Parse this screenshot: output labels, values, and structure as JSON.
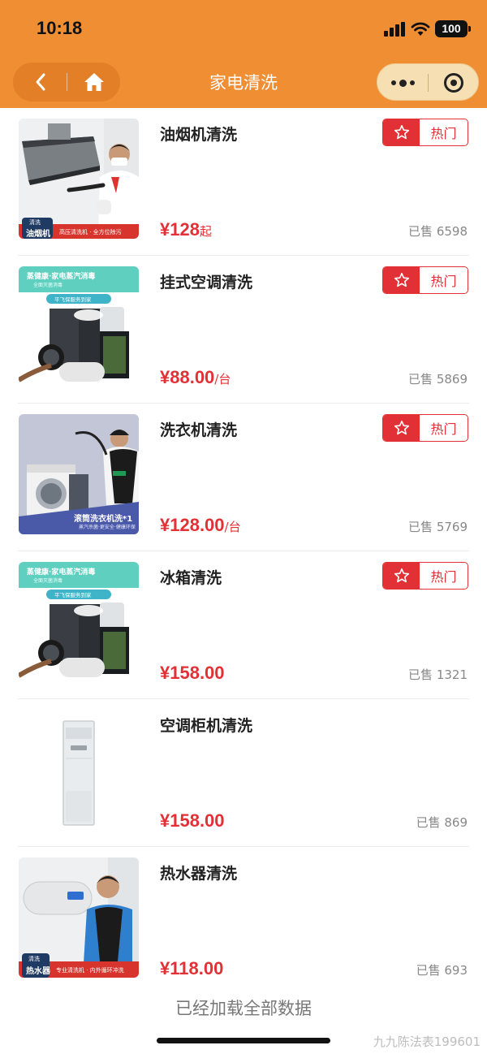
{
  "status_bar": {
    "time": "10:18",
    "battery": "100"
  },
  "nav": {
    "title": "家电清洗"
  },
  "items": [
    {
      "title": "油烟机清洗",
      "price": "¥128",
      "unit": "起",
      "sold": "已售 6598",
      "hot": "热门",
      "img": {
        "tag": "清洗",
        "name": "油烟机",
        "strip": "高压清洗机 · 全方位除污"
      }
    },
    {
      "title": "挂式空调清洗",
      "price": "¥88.00",
      "unit": "/台",
      "sold": "已售 5869",
      "hot": "热门",
      "img": {
        "banner": "蒸健康·家电蒸汽消毒",
        "sub": "全面灭菌消毒",
        "badge": "平飞保服务到家"
      }
    },
    {
      "title": "洗衣机清洗",
      "price": "¥128.00",
      "unit": "/台",
      "sold": "已售 5769",
      "hot": "热门",
      "img": {
        "caption": "滚筒洗衣机洗*1",
        "sub": "蒸汽杀菌·更安全·健康环保"
      }
    },
    {
      "title": "冰箱清洗",
      "price": "¥158.00",
      "unit": "",
      "sold": "已售 1321",
      "hot": "热门",
      "img": {
        "banner": "蒸健康·家电蒸汽消毒",
        "sub": "全面灭菌消毒",
        "badge": "平飞保服务到家"
      }
    },
    {
      "title": "空调柜机清洗",
      "price": "¥158.00",
      "unit": "",
      "sold": "已售 869",
      "hot": ""
    },
    {
      "title": "热水器清洗",
      "price": "¥118.00",
      "unit": "",
      "sold": "已售 693",
      "hot": "",
      "img": {
        "tag": "清洗",
        "name": "热水器",
        "strip": "专业清洗机 · 内外循环冲洗"
      }
    }
  ],
  "footer": {
    "end_text": "已经加载全部数据",
    "watermark": "九九陈法表199601"
  },
  "colors": {
    "header": "#f08e34",
    "accent": "#e23136",
    "capsule": "#f6dfb2"
  }
}
